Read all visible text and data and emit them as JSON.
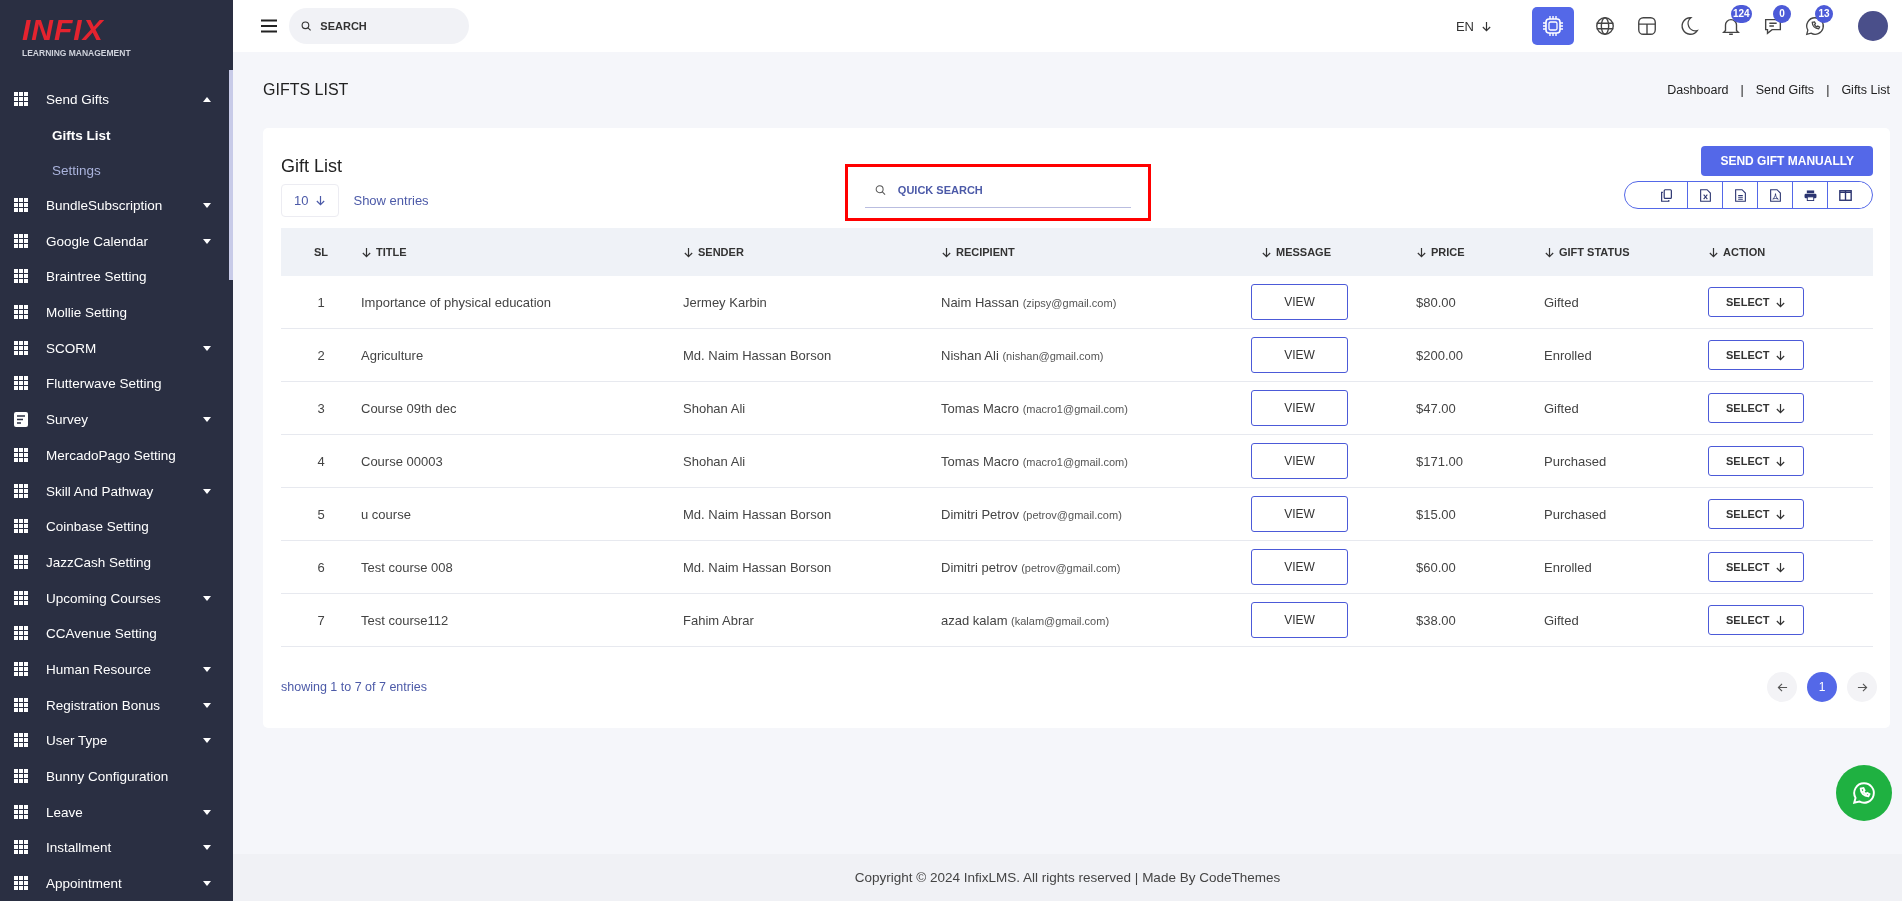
{
  "logo": {
    "wordmark": "INFIX",
    "tagline": "LEARNING MANAGEMENT"
  },
  "sidebar": {
    "items": [
      {
        "label": "Send Gifts",
        "kind": "grid",
        "submenu": true,
        "expanded": true,
        "children": [
          {
            "label": "Gifts List",
            "selected": true
          },
          {
            "label": "Settings",
            "selected": false
          }
        ]
      },
      {
        "label": "BundleSubscription",
        "kind": "grid",
        "submenu": true,
        "expanded": false
      },
      {
        "label": "Google Calendar",
        "kind": "grid",
        "submenu": true,
        "expanded": false
      },
      {
        "label": "Braintree Setting",
        "kind": "grid",
        "submenu": false
      },
      {
        "label": "Mollie Setting",
        "kind": "grid",
        "submenu": false
      },
      {
        "label": "SCORM",
        "kind": "grid",
        "submenu": true,
        "expanded": false
      },
      {
        "label": "Flutterwave Setting",
        "kind": "grid",
        "submenu": false
      },
      {
        "label": "Survey",
        "kind": "form",
        "submenu": true,
        "expanded": false
      },
      {
        "label": "MercadoPago Setting",
        "kind": "grid",
        "submenu": false
      },
      {
        "label": "Skill And Pathway",
        "kind": "grid",
        "submenu": true,
        "expanded": false
      },
      {
        "label": "Coinbase Setting",
        "kind": "grid",
        "submenu": false
      },
      {
        "label": "JazzCash Setting",
        "kind": "grid",
        "submenu": false
      },
      {
        "label": "Upcoming Courses",
        "kind": "grid",
        "submenu": true,
        "expanded": false
      },
      {
        "label": "CCAvenue Setting",
        "kind": "grid",
        "submenu": false
      },
      {
        "label": "Human Resource",
        "kind": "grid",
        "submenu": true,
        "expanded": false
      },
      {
        "label": "Registration Bonus",
        "kind": "grid",
        "submenu": true,
        "expanded": false
      },
      {
        "label": "User Type",
        "kind": "grid",
        "submenu": true,
        "expanded": false
      },
      {
        "label": "Bunny Configuration",
        "kind": "grid",
        "submenu": false
      },
      {
        "label": "Leave",
        "kind": "grid",
        "submenu": true,
        "expanded": false
      },
      {
        "label": "Installment",
        "kind": "grid",
        "submenu": true,
        "expanded": false
      },
      {
        "label": "Appointment",
        "kind": "grid",
        "submenu": true,
        "expanded": false
      }
    ]
  },
  "topbar": {
    "search": {
      "placeholder": "SEARCH"
    },
    "language": "EN",
    "badges": [
      {
        "kind": "bell",
        "count": "124"
      },
      {
        "kind": "chat",
        "count": "0"
      },
      {
        "kind": "whatsapp",
        "count": "13"
      }
    ]
  },
  "page": {
    "title": "GIFTS LIST",
    "breadcrumb": [
      "Dashboard",
      "Send Gifts",
      "Gifts List"
    ],
    "breadcrumb_separator": "|"
  },
  "card": {
    "title": "Gift List",
    "page_size": "10",
    "show_entries": "Show entries",
    "quick_search": {
      "placeholder": "QUICK SEARCH"
    },
    "send_button": "SEND GIFT MANUALLY",
    "columns": [
      {
        "label": "SL",
        "sortable": false
      },
      {
        "label": "TITLE",
        "sortable": true
      },
      {
        "label": "SENDER",
        "sortable": true
      },
      {
        "label": "RECIPIENT",
        "sortable": true
      },
      {
        "label": "MESSAGE",
        "sortable": true
      },
      {
        "label": "PRICE",
        "sortable": true
      },
      {
        "label": "GIFT STATUS",
        "sortable": true
      },
      {
        "label": "ACTION",
        "sortable": true
      }
    ],
    "rows": [
      {
        "sl": "1",
        "title": "Importance of physical education",
        "sender": "Jermey Karbin",
        "recipient_name": "Naim Hassan",
        "recipient_email": "(zipsy@gmail.com)",
        "message": "VIEW",
        "price": "$80.00",
        "status": "Gifted",
        "action": "SELECT"
      },
      {
        "sl": "2",
        "title": "Agriculture",
        "sender": "Md. Naim Hassan Borson",
        "recipient_name": "Nishan Ali",
        "recipient_email": "(nishan@gmail.com)",
        "message": "VIEW",
        "price": "$200.00",
        "status": "Enrolled",
        "action": "SELECT"
      },
      {
        "sl": "3",
        "title": "Course 09th dec",
        "sender": "Shohan Ali",
        "recipient_name": "Tomas Macro",
        "recipient_email": "(macro1@gmail.com)",
        "message": "VIEW",
        "price": "$47.00",
        "status": "Gifted",
        "action": "SELECT"
      },
      {
        "sl": "4",
        "title": "Course 00003",
        "sender": "Shohan Ali",
        "recipient_name": "Tomas Macro",
        "recipient_email": "(macro1@gmail.com)",
        "message": "VIEW",
        "price": "$171.00",
        "status": "Purchased",
        "action": "SELECT"
      },
      {
        "sl": "5",
        "title": "u course",
        "sender": "Md. Naim Hassan Borson",
        "recipient_name": "Dimitri Petrov",
        "recipient_email": "(petrov@gmail.com)",
        "message": "VIEW",
        "price": "$15.00",
        "status": "Purchased",
        "action": "SELECT"
      },
      {
        "sl": "6",
        "title": "Test course 008",
        "sender": "Md. Naim Hassan Borson",
        "recipient_name": "Dimitri petrov",
        "recipient_email": "(petrov@gmail.com)",
        "message": "VIEW",
        "price": "$60.00",
        "status": "Enrolled",
        "action": "SELECT"
      },
      {
        "sl": "7",
        "title": "Test course112",
        "sender": "Fahim Abrar",
        "recipient_name": "azad kalam",
        "recipient_email": "(kalam@gmail.com)",
        "message": "VIEW",
        "price": "$38.00",
        "status": "Gifted",
        "action": "SELECT"
      }
    ],
    "summary": "showing 1 to 7 of 7 entries",
    "pages": [
      {
        "label": "1",
        "selected": true
      }
    ]
  },
  "footer": "Copyright © 2024 InfixLMS. All rights reserved | Made By CodeThemes"
}
